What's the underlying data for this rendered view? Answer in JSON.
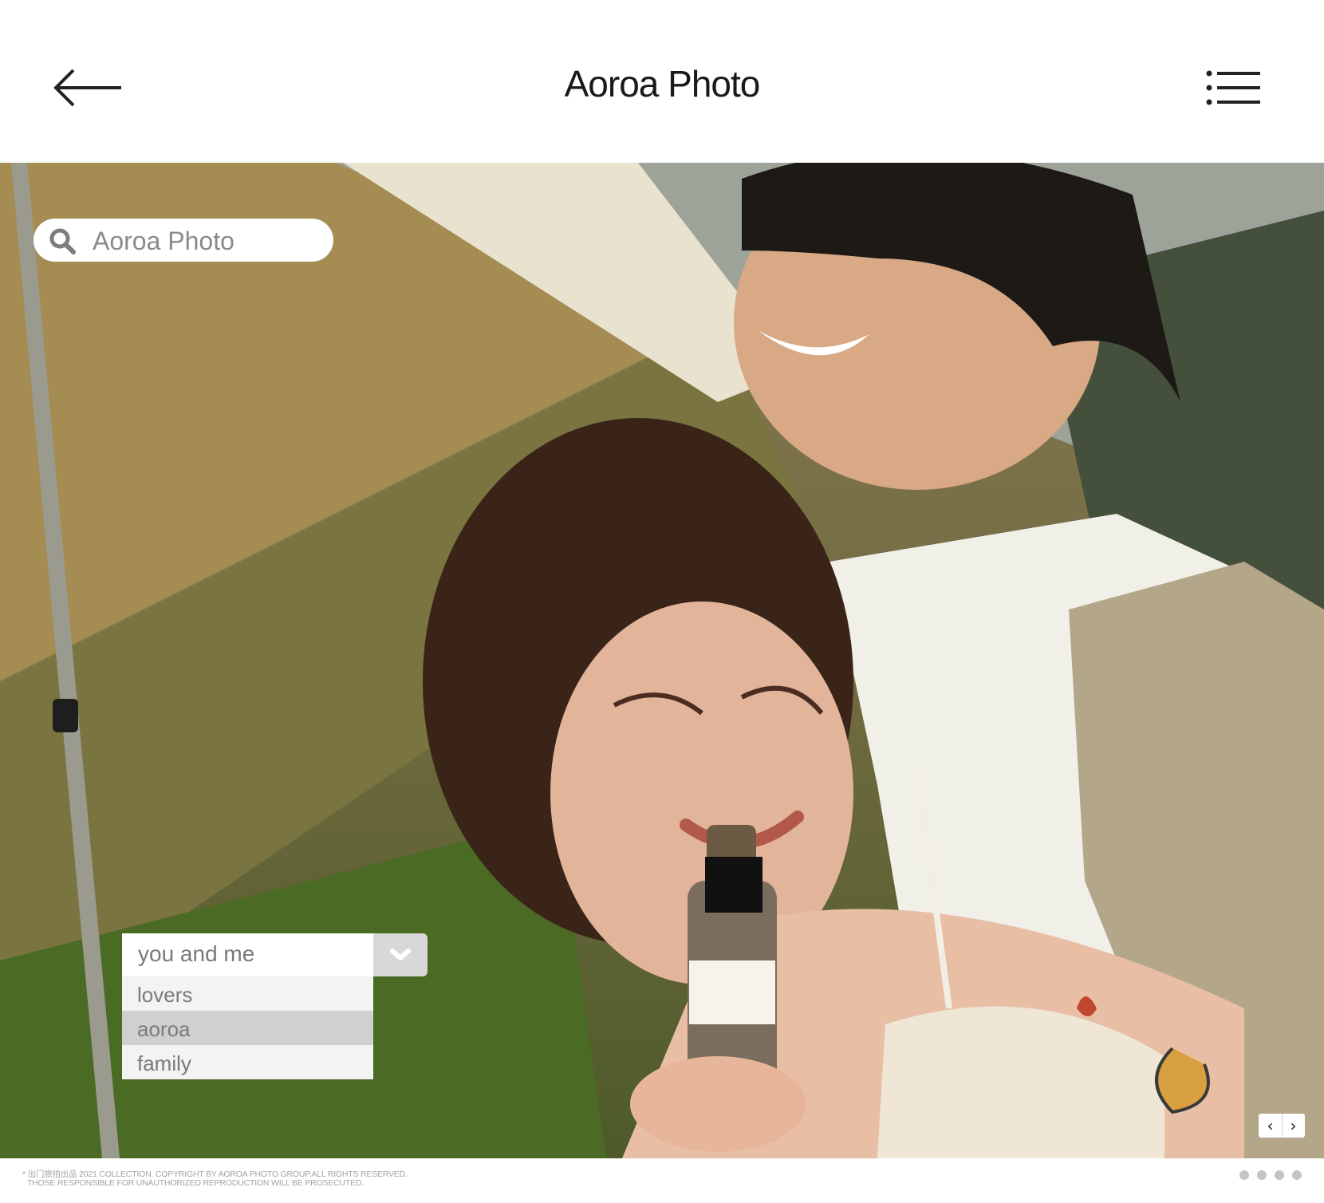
{
  "header": {
    "title": "Aoroa Photo",
    "back_icon": "arrow-left-icon",
    "menu_icon": "list-menu-icon"
  },
  "search": {
    "placeholder": "Aoroa Photo",
    "icon": "search-icon"
  },
  "dropdown": {
    "selected": "you and me",
    "toggle_icon": "chevron-down-icon",
    "options": [
      "lovers",
      "aoroa",
      "family"
    ],
    "highlighted_option": "aoroa"
  },
  "slider": {
    "prev": "‹",
    "next": "›",
    "dots_count": 4
  },
  "footer": {
    "line1": "* 出门旅拍出品 2021 COLLECTION. COPYRIGHT BY AOROA PHOTO GROUP.ALL RIGHTS RESERVED.",
    "line2": "THOSE RESPONSIBLE FOR UNAUTHORIZED REPRODUCTION WILL BE PROSECUTED."
  },
  "colors": {
    "text": "#1a1a1a",
    "muted": "#8a8a8a",
    "dropdown_highlight": "#d0d0d0",
    "dot": "#c4c4c4"
  }
}
